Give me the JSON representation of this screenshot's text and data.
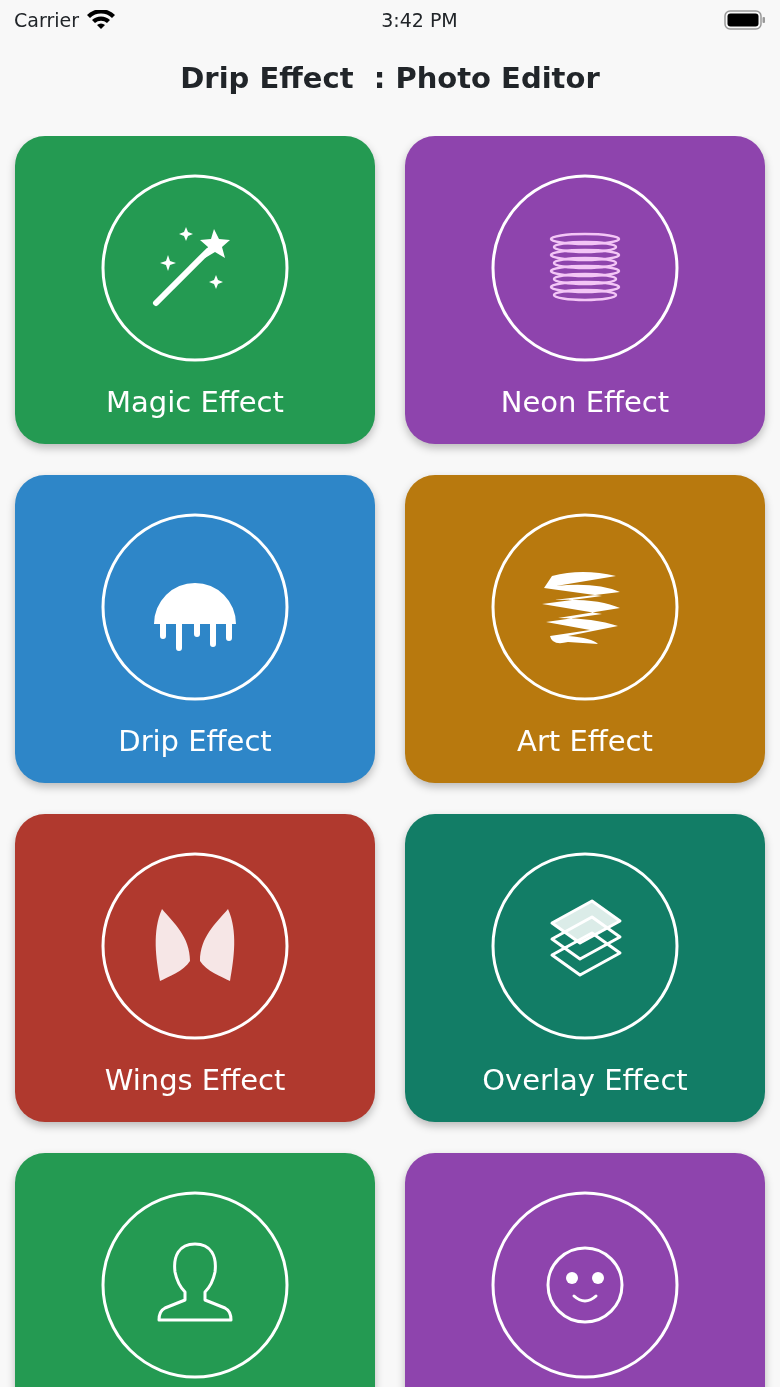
{
  "status_bar": {
    "carrier": "Carrier",
    "time": "3:42 PM"
  },
  "title": "Drip Effect  : Photo Editor",
  "cards": [
    {
      "label": "Magic Effect",
      "color": "#249a52"
    },
    {
      "label": "Neon Effect",
      "color": "#8e44ad"
    },
    {
      "label": "Drip Effect",
      "color": "#2e86c8"
    },
    {
      "label": "Art Effect",
      "color": "#b8790e"
    },
    {
      "label": "Wings Effect",
      "color": "#b0392e"
    },
    {
      "label": "Overlay Effect",
      "color": "#127d66"
    },
    {
      "color": "#249a52"
    },
    {
      "color": "#8e44ad"
    }
  ]
}
